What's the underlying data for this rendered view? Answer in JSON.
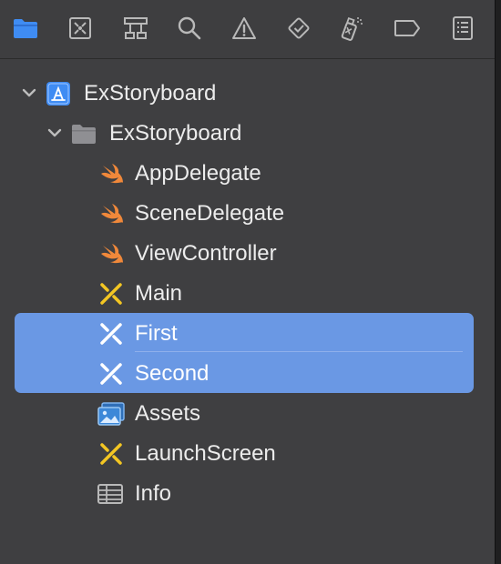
{
  "toolbar": {
    "items": [
      {
        "name": "project-navigator",
        "icon": "folder-icon",
        "selected": true
      },
      {
        "name": "source-control-navigator",
        "icon": "source-control-icon"
      },
      {
        "name": "symbol-navigator",
        "icon": "hierarchy-icon"
      },
      {
        "name": "find-navigator",
        "icon": "search-icon"
      },
      {
        "name": "issue-navigator",
        "icon": "warning-icon"
      },
      {
        "name": "test-navigator",
        "icon": "test-diamond-icon"
      },
      {
        "name": "debug-navigator",
        "icon": "spray-can-icon"
      },
      {
        "name": "breakpoint-navigator",
        "icon": "breakpoint-tag-icon"
      },
      {
        "name": "report-navigator",
        "icon": "report-list-icon"
      }
    ]
  },
  "tree": {
    "items": [
      {
        "label": "ExStoryboard",
        "icon": "xcode-project-icon",
        "expanded": true
      },
      {
        "label": "ExStoryboard",
        "icon": "folder-icon",
        "expanded": true
      },
      {
        "label": "AppDelegate",
        "icon": "swift-icon"
      },
      {
        "label": "SceneDelegate",
        "icon": "swift-icon"
      },
      {
        "label": "ViewController",
        "icon": "swift-icon"
      },
      {
        "label": "Main",
        "icon": "storyboard-icon"
      },
      {
        "label": "First",
        "icon": "storyboard-icon",
        "selected": true
      },
      {
        "label": "Second",
        "icon": "storyboard-icon",
        "selected": true
      },
      {
        "label": "Assets",
        "icon": "asset-catalog-icon"
      },
      {
        "label": "LaunchScreen",
        "icon": "storyboard-icon"
      },
      {
        "label": "Info",
        "icon": "plist-table-icon"
      }
    ]
  },
  "colors": {
    "background": "#3f3f41",
    "selection": "#6a98e4",
    "accent_blue": "#3f8cf3",
    "swift_orange": "#f0883a",
    "storyboard_yellow": "#f3c623",
    "text": "#ececec"
  }
}
